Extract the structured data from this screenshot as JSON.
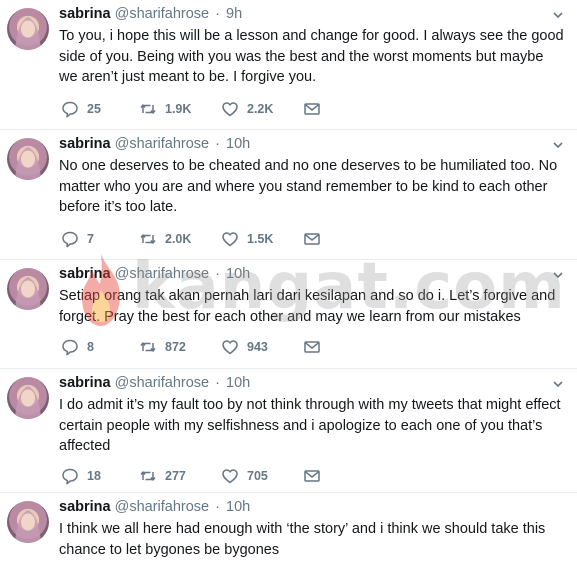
{
  "tweets": [
    {
      "name": "sabrina",
      "handle": "@sharifahrose",
      "separator": "·",
      "time": "9h",
      "text": "To you, i hope this will be a lesson and change for good. I always see the good side of you. Being with you was the best and the worst moments but maybe we aren’t just meant to be. I forgive you.",
      "replies": "25",
      "retweets": "1.9K",
      "likes": "2.2K"
    },
    {
      "name": "sabrina",
      "handle": "@sharifahrose",
      "separator": "·",
      "time": "10h",
      "text": "No one deserves to be cheated and no one deserves to be humiliated too. No matter who you are and where you stand remember to be kind to each other before it’s too late.",
      "replies": "7",
      "retweets": "2.0K",
      "likes": "1.5K"
    },
    {
      "name": "sabrina",
      "handle": "@sharifahrose",
      "separator": "·",
      "time": "10h",
      "text": "Setiap orang tak akan pernah lari dari kesilapan and so do i. Let’s forgive and forget. Pray the best for each other and may we learn from our mistakes",
      "replies": "8",
      "retweets": "872",
      "likes": "943"
    },
    {
      "name": "sabrina",
      "handle": "@sharifahrose",
      "separator": "·",
      "time": "10h",
      "text": "I do admit it’s my fault too by not think through with my tweets that might effect certain people with my selfishness and i apologize to each one of you that’s affected",
      "replies": "18",
      "retweets": "277",
      "likes": "705"
    },
    {
      "name": "sabrina",
      "handle": "@sharifahrose",
      "separator": "·",
      "time": "10h",
      "text": "I think we all here had enough with ‘the story’ and i think we should take this chance to let bygones be bygones"
    }
  ],
  "watermark": {
    "text": "kangat.com"
  },
  "icons": {
    "reply": "reply-icon",
    "retweet": "retweet-icon",
    "like": "heart-icon",
    "dm": "envelope-icon",
    "more": "chevron-down-icon"
  },
  "colors": {
    "icon": "#657786",
    "text": "#14171a",
    "muted": "#657786",
    "divider": "#e6ecf0"
  }
}
